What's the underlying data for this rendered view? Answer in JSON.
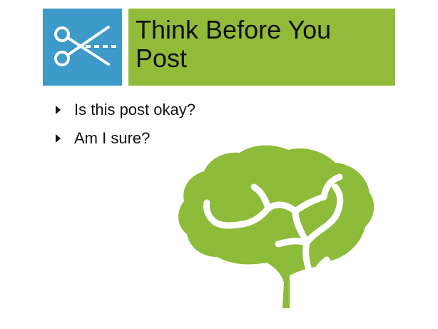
{
  "slide": {
    "title": "Think Before You Post",
    "bullets": [
      "Is this post okay?",
      "Am I sure?"
    ]
  },
  "icons": {
    "header_icon": "scissors-icon",
    "illustration": "brain-icon"
  },
  "colors": {
    "icon_box": "#3d9ac9",
    "title_box": "#93bb3a",
    "brain": "#8dbb3a"
  }
}
